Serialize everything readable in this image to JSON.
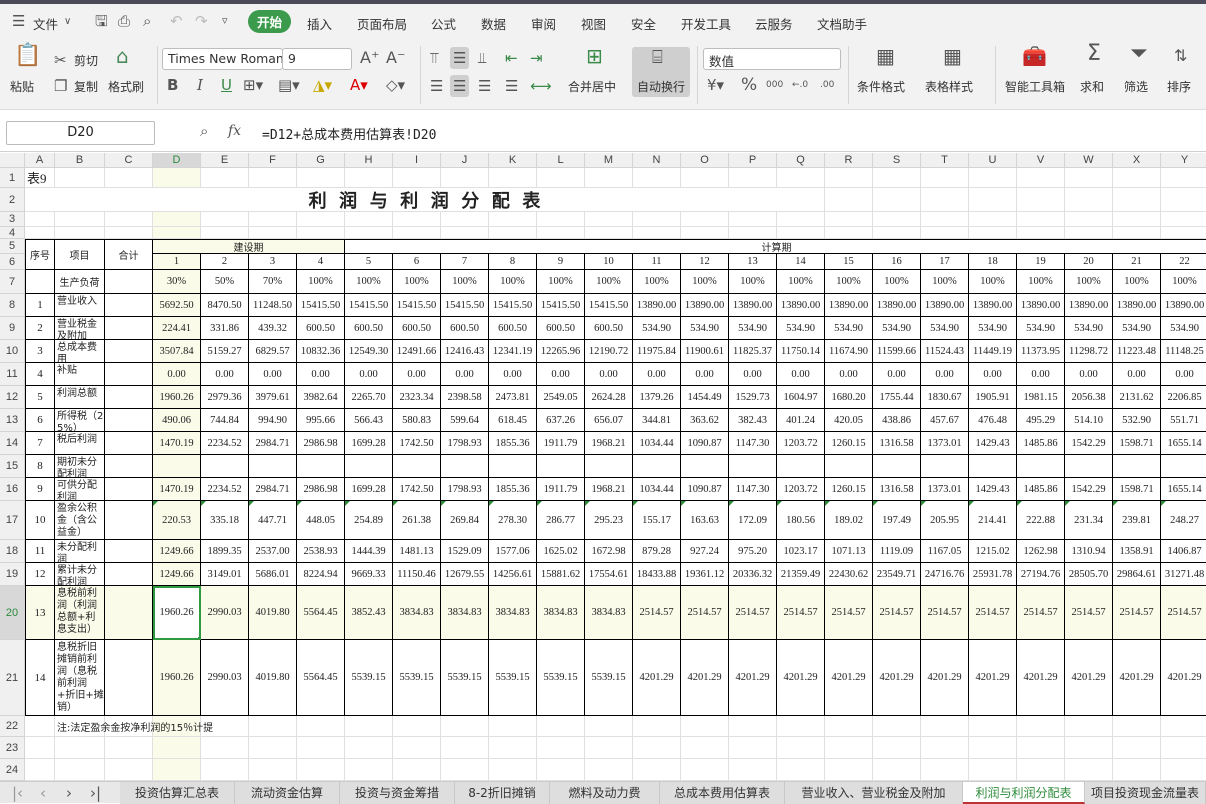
{
  "menubar": {
    "file_label": "文件",
    "tabs": [
      "开始",
      "插入",
      "页面布局",
      "公式",
      "数据",
      "审阅",
      "视图",
      "安全",
      "开发工具",
      "云服务",
      "文档助手"
    ],
    "active_tab": "开始"
  },
  "ribbon": {
    "paste": "粘贴",
    "cut": "剪切",
    "copy": "复制",
    "format_painter": "格式刷",
    "font_name": "Times New Roman",
    "font_size": "9",
    "bold": "B",
    "italic": "I",
    "underline": "U",
    "merge_center": "合并居中",
    "wrap_text": "自动换行",
    "number_format": "数值",
    "conditional_format": "条件格式",
    "table_style": "表格样式",
    "smart_toolbox": "智能工具箱",
    "sum": "求和",
    "filter": "筛选",
    "sort": "排序"
  },
  "formula_bar": {
    "cell_ref": "D20",
    "fx": "fx",
    "formula": "=D12+总成本费用估算表!D20"
  },
  "sheet": {
    "columns": [
      "A",
      "B",
      "C",
      "D",
      "E",
      "F",
      "G",
      "H",
      "I",
      "J",
      "K",
      "L",
      "M",
      "N",
      "O",
      "P",
      "Q",
      "R",
      "S",
      "T",
      "U",
      "V",
      "W",
      "X",
      "Y"
    ],
    "row_numbers": [
      "1",
      "2",
      "3",
      "4",
      "5",
      "6",
      "7",
      "8",
      "9",
      "10",
      "11",
      "12",
      "13",
      "14",
      "15",
      "16",
      "17",
      "18",
      "19",
      "20",
      "21",
      "22",
      "23",
      "24"
    ],
    "table_no": "表9",
    "title": "利  润  与  利  润  分  配  表",
    "header": {
      "seq": "序号",
      "item": "项目",
      "total": "合计",
      "construction": "建设期",
      "calculation": "计算期",
      "periods": [
        "1",
        "2",
        "3",
        "4",
        "5",
        "6",
        "7",
        "8",
        "9",
        "10",
        "11",
        "12",
        "13",
        "14",
        "15",
        "16",
        "17",
        "18",
        "19",
        "20",
        "21",
        "22"
      ]
    },
    "rows": [
      {
        "seq": "",
        "item": "生产负荷",
        "values": [
          "30%",
          "50%",
          "70%",
          "100%",
          "100%",
          "100%",
          "100%",
          "100%",
          "100%",
          "100%",
          "100%",
          "100%",
          "100%",
          "100%",
          "100%",
          "100%",
          "100%",
          "100%",
          "100%",
          "100%",
          "100%",
          "100%"
        ]
      },
      {
        "seq": "1",
        "item": "营业收入",
        "values": [
          "5692.50",
          "8470.50",
          "11248.50",
          "15415.50",
          "15415.50",
          "15415.50",
          "15415.50",
          "15415.50",
          "15415.50",
          "15415.50",
          "13890.00",
          "13890.00",
          "13890.00",
          "13890.00",
          "13890.00",
          "13890.00",
          "13890.00",
          "13890.00",
          "13890.00",
          "13890.00",
          "13890.00",
          "13890.00"
        ]
      },
      {
        "seq": "2",
        "item": "营业税金及附加",
        "values": [
          "224.41",
          "331.86",
          "439.32",
          "600.50",
          "600.50",
          "600.50",
          "600.50",
          "600.50",
          "600.50",
          "600.50",
          "534.90",
          "534.90",
          "534.90",
          "534.90",
          "534.90",
          "534.90",
          "534.90",
          "534.90",
          "534.90",
          "534.90",
          "534.90",
          "534.90"
        ]
      },
      {
        "seq": "3",
        "item": "总成本费用",
        "values": [
          "3507.84",
          "5159.27",
          "6829.57",
          "10832.36",
          "12549.30",
          "12491.66",
          "12416.43",
          "12341.19",
          "12265.96",
          "12190.72",
          "11975.84",
          "11900.61",
          "11825.37",
          "11750.14",
          "11674.90",
          "11599.66",
          "11524.43",
          "11449.19",
          "11373.95",
          "11298.72",
          "11223.48",
          "11148.25"
        ]
      },
      {
        "seq": "4",
        "item": "补贴",
        "values": [
          "0.00",
          "0.00",
          "0.00",
          "0.00",
          "0.00",
          "0.00",
          "0.00",
          "0.00",
          "0.00",
          "0.00",
          "0.00",
          "0.00",
          "0.00",
          "0.00",
          "0.00",
          "0.00",
          "0.00",
          "0.00",
          "0.00",
          "0.00",
          "0.00",
          "0.00"
        ]
      },
      {
        "seq": "5",
        "item": "利润总额",
        "values": [
          "1960.26",
          "2979.36",
          "3979.61",
          "3982.64",
          "2265.70",
          "2323.34",
          "2398.58",
          "2473.81",
          "2549.05",
          "2624.28",
          "1379.26",
          "1454.49",
          "1529.73",
          "1604.97",
          "1680.20",
          "1755.44",
          "1830.67",
          "1905.91",
          "1981.15",
          "2056.38",
          "2131.62",
          "2206.85"
        ]
      },
      {
        "seq": "6",
        "item": "所得税（25%）",
        "values": [
          "490.06",
          "744.84",
          "994.90",
          "995.66",
          "566.43",
          "580.83",
          "599.64",
          "618.45",
          "637.26",
          "656.07",
          "344.81",
          "363.62",
          "382.43",
          "401.24",
          "420.05",
          "438.86",
          "457.67",
          "476.48",
          "495.29",
          "514.10",
          "532.90",
          "551.71"
        ]
      },
      {
        "seq": "7",
        "item": "税后利润",
        "values": [
          "1470.19",
          "2234.52",
          "2984.71",
          "2986.98",
          "1699.28",
          "1742.50",
          "1798.93",
          "1855.36",
          "1911.79",
          "1968.21",
          "1034.44",
          "1090.87",
          "1147.30",
          "1203.72",
          "1260.15",
          "1316.58",
          "1373.01",
          "1429.43",
          "1485.86",
          "1542.29",
          "1598.71",
          "1655.14"
        ]
      },
      {
        "seq": "8",
        "item": "期初未分配利润",
        "values": [
          "",
          "",
          "",
          "",
          "",
          "",
          "",
          "",
          "",
          "",
          "",
          "",
          "",
          "",
          "",
          "",
          "",
          "",
          "",
          "",
          "",
          ""
        ]
      },
      {
        "seq": "9",
        "item": "可供分配利润",
        "values": [
          "1470.19",
          "2234.52",
          "2984.71",
          "2986.98",
          "1699.28",
          "1742.50",
          "1798.93",
          "1855.36",
          "1911.79",
          "1968.21",
          "1034.44",
          "1090.87",
          "1147.30",
          "1203.72",
          "1260.15",
          "1316.58",
          "1373.01",
          "1429.43",
          "1485.86",
          "1542.29",
          "1598.71",
          "1655.14"
        ]
      },
      {
        "seq": "10",
        "item": "盈余公积金（含公益金）",
        "values": [
          "220.53",
          "335.18",
          "447.71",
          "448.05",
          "254.89",
          "261.38",
          "269.84",
          "278.30",
          "286.77",
          "295.23",
          "155.17",
          "163.63",
          "172.09",
          "180.56",
          "189.02",
          "197.49",
          "205.95",
          "214.41",
          "222.88",
          "231.34",
          "239.81",
          "248.27"
        ]
      },
      {
        "seq": "11",
        "item": "未分配利润",
        "values": [
          "1249.66",
          "1899.35",
          "2537.00",
          "2538.93",
          "1444.39",
          "1481.13",
          "1529.09",
          "1577.06",
          "1625.02",
          "1672.98",
          "879.28",
          "927.24",
          "975.20",
          "1023.17",
          "1071.13",
          "1119.09",
          "1167.05",
          "1215.02",
          "1262.98",
          "1310.94",
          "1358.91",
          "1406.87"
        ]
      },
      {
        "seq": "12",
        "item": "累计未分配利润",
        "values": [
          "1249.66",
          "3149.01",
          "5686.01",
          "8224.94",
          "9669.33",
          "11150.46",
          "12679.55",
          "14256.61",
          "15881.62",
          "17554.61",
          "18433.88",
          "19361.12",
          "20336.32",
          "21359.49",
          "22430.62",
          "23549.71",
          "24716.76",
          "25931.78",
          "27194.76",
          "28505.70",
          "29864.61",
          "31271.48"
        ]
      },
      {
        "seq": "13",
        "item": "息税前利润（利润总额+利息支出）",
        "values": [
          "1960.26",
          "2990.03",
          "4019.80",
          "5564.45",
          "3852.43",
          "3834.83",
          "3834.83",
          "3834.83",
          "3834.83",
          "3834.83",
          "2514.57",
          "2514.57",
          "2514.57",
          "2514.57",
          "2514.57",
          "2514.57",
          "2514.57",
          "2514.57",
          "2514.57",
          "2514.57",
          "2514.57",
          "2514.57"
        ]
      },
      {
        "seq": "14",
        "item": "息税折旧摊销前利润（息税前利润+折旧+摊销）",
        "values": [
          "1960.26",
          "2990.03",
          "4019.80",
          "5564.45",
          "5539.15",
          "5539.15",
          "5539.15",
          "5539.15",
          "5539.15",
          "5539.15",
          "4201.29",
          "4201.29",
          "4201.29",
          "4201.29",
          "4201.29",
          "4201.29",
          "4201.29",
          "4201.29",
          "4201.29",
          "4201.29",
          "4201.29",
          "4201.29"
        ]
      }
    ],
    "note": "注:法定盈余金按净利润的15％计提",
    "selected_cell": "D20"
  },
  "sheet_tabs": {
    "tabs": [
      "投资估算汇总表",
      "流动资金估算",
      "投资与资金筹措",
      "8-2折旧摊销",
      "燃料及动力费",
      "总成本费用估算表",
      "营业收入、营业税金及附加",
      "利润与利润分配表",
      "项目投资现金流量表"
    ],
    "active": "利润与利润分配表"
  },
  "colors": {
    "accent": "#3c9a4c",
    "selection": "#2f9a3f",
    "active_tab_underline": "#bb3333",
    "highlight": "#fbfbea"
  }
}
